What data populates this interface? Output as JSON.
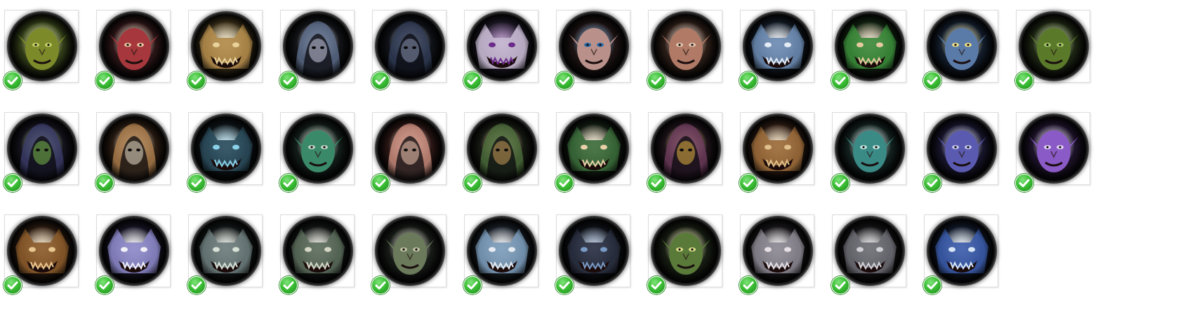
{
  "window": {
    "title": ""
  },
  "icons": [
    {
      "name": "orc-grunt-icon",
      "bg": "#2f3a16",
      "face": "#7c8a2a",
      "accent": "#c9d36a",
      "shape": "face"
    },
    {
      "name": "blood-elf-icon",
      "bg": "#2a1416",
      "face": "#a6373c",
      "accent": "#e8c3a0",
      "shape": "face"
    },
    {
      "name": "golden-beast-icon",
      "bg": "#3a2f18",
      "face": "#b08a4a",
      "accent": "#e8d29a",
      "shape": "beast"
    },
    {
      "name": "hooded-wraith-icon",
      "bg": "#121418",
      "face": "#5b6a86",
      "accent": "#c9cbe0",
      "shape": "hood"
    },
    {
      "name": "hooded-cultist-icon",
      "bg": "#0f1218",
      "face": "#2f3a52",
      "accent": "#8a94b0",
      "shape": "hood"
    },
    {
      "name": "roaring-bear-icon",
      "bg": "#1c1824",
      "face": "#c6b9d2",
      "accent": "#6a2a8a",
      "shape": "beast"
    },
    {
      "name": "screaming-warrior-icon",
      "bg": "#1c1212",
      "face": "#b9918a",
      "accent": "#2a6aa8",
      "shape": "face"
    },
    {
      "name": "old-dwarf-icon",
      "bg": "#2a1c16",
      "face": "#b07a66",
      "accent": "#e6c7b0",
      "shape": "face"
    },
    {
      "name": "spectral-wolf-icon",
      "bg": "#121a24",
      "face": "#6a8ab0",
      "accent": "#e4ecf6",
      "shape": "beast"
    },
    {
      "name": "green-troll-icon",
      "bg": "#122412",
      "face": "#3a8a3a",
      "accent": "#e8caa0",
      "shape": "beast"
    },
    {
      "name": "blue-undead-icon",
      "bg": "#121c2a",
      "face": "#5a7aa8",
      "accent": "#f0e08a",
      "shape": "face"
    },
    {
      "name": "green-orc-elder-icon",
      "bg": "#1c2412",
      "face": "#5a7a2a",
      "accent": "#a8c86a",
      "shape": "face"
    },
    {
      "name": "shadow-hood-icon",
      "bg": "#14121c",
      "face": "#3a3a66",
      "accent": "#7ab84a",
      "shape": "hood"
    },
    {
      "name": "hooded-sage-icon",
      "bg": "#2a1c12",
      "face": "#a87a4a",
      "accent": "#e8dcc6",
      "shape": "hood"
    },
    {
      "name": "dark-spider-icon",
      "bg": "#0e1418",
      "face": "#2a4a5a",
      "accent": "#8ad0e8",
      "shape": "beast"
    },
    {
      "name": "swamp-hag-icon",
      "bg": "#121c18",
      "face": "#3a8a6a",
      "accent": "#c6d6c6",
      "shape": "face"
    },
    {
      "name": "fur-hooded-dwarf-icon",
      "bg": "#2a1614",
      "face": "#c68a7a",
      "accent": "#f0c6b0",
      "shape": "hood"
    },
    {
      "name": "hooded-troll-icon",
      "bg": "#161a12",
      "face": "#4a6a3a",
      "accent": "#c89a5a",
      "shape": "hood"
    },
    {
      "name": "green-croc-icon",
      "bg": "#121c12",
      "face": "#3a6a3a",
      "accent": "#e8d0a8",
      "shape": "beast"
    },
    {
      "name": "masked-assassin-icon",
      "bg": "#1c1218",
      "face": "#6a3a5a",
      "accent": "#e0b040",
      "shape": "hood"
    },
    {
      "name": "wild-boar-icon",
      "bg": "#2a1a12",
      "face": "#9a6a3a",
      "accent": "#e0c08a",
      "shape": "beast"
    },
    {
      "name": "teal-ogre-icon",
      "bg": "#12201e",
      "face": "#3a8a86",
      "accent": "#c6e6e0",
      "shape": "face"
    },
    {
      "name": "violet-elf-icon",
      "bg": "#16142a",
      "face": "#5a5ab0",
      "accent": "#c6c6f0",
      "shape": "face"
    },
    {
      "name": "purple-demon-icon",
      "bg": "#1c1228",
      "face": "#8a5ac6",
      "accent": "#e6d6f6",
      "shape": "face"
    },
    {
      "name": "tauren-icon",
      "bg": "#2a1a10",
      "face": "#8a5a2a",
      "accent": "#e8c690",
      "shape": "beast"
    },
    {
      "name": "frost-dragon-icon",
      "bg": "#161424",
      "face": "#8a86c6",
      "accent": "#f0f0f6",
      "shape": "beast"
    },
    {
      "name": "bone-dragon-icon",
      "bg": "#141818",
      "face": "#6a7a7a",
      "accent": "#d6e0d6",
      "shape": "beast"
    },
    {
      "name": "saber-skull-icon",
      "bg": "#121614",
      "face": "#5a6a5a",
      "accent": "#d6d6c6",
      "shape": "beast"
    },
    {
      "name": "undead-champion-icon",
      "bg": "#161a16",
      "face": "#6a7a5a",
      "accent": "#c6c6a8",
      "shape": "face"
    },
    {
      "name": "storm-wolf-icon",
      "bg": "#1a2028",
      "face": "#7a9ab8",
      "accent": "#e6ecf2",
      "shape": "beast"
    },
    {
      "name": "shadow-spider-icon",
      "bg": "#0e1016",
      "face": "#2a3040",
      "accent": "#7a9ac6",
      "shape": "beast"
    },
    {
      "name": "goblin-gunner-icon",
      "bg": "#161c12",
      "face": "#5a7a3a",
      "accent": "#e0e08a",
      "shape": "face"
    },
    {
      "name": "skeletal-wyrm-icon",
      "bg": "#18161a",
      "face": "#8a8690",
      "accent": "#e6e0e6",
      "shape": "beast"
    },
    {
      "name": "raptor-skull-icon",
      "bg": "#141416",
      "face": "#6a6a72",
      "accent": "#d0d0d6",
      "shape": "beast"
    },
    {
      "name": "blue-spirit-wolf-icon",
      "bg": "#101828",
      "face": "#3a5aa8",
      "accent": "#d6e6f6",
      "shape": "beast"
    }
  ],
  "check_icon": {
    "name": "completed-check-icon",
    "color": "#3bbf35"
  }
}
